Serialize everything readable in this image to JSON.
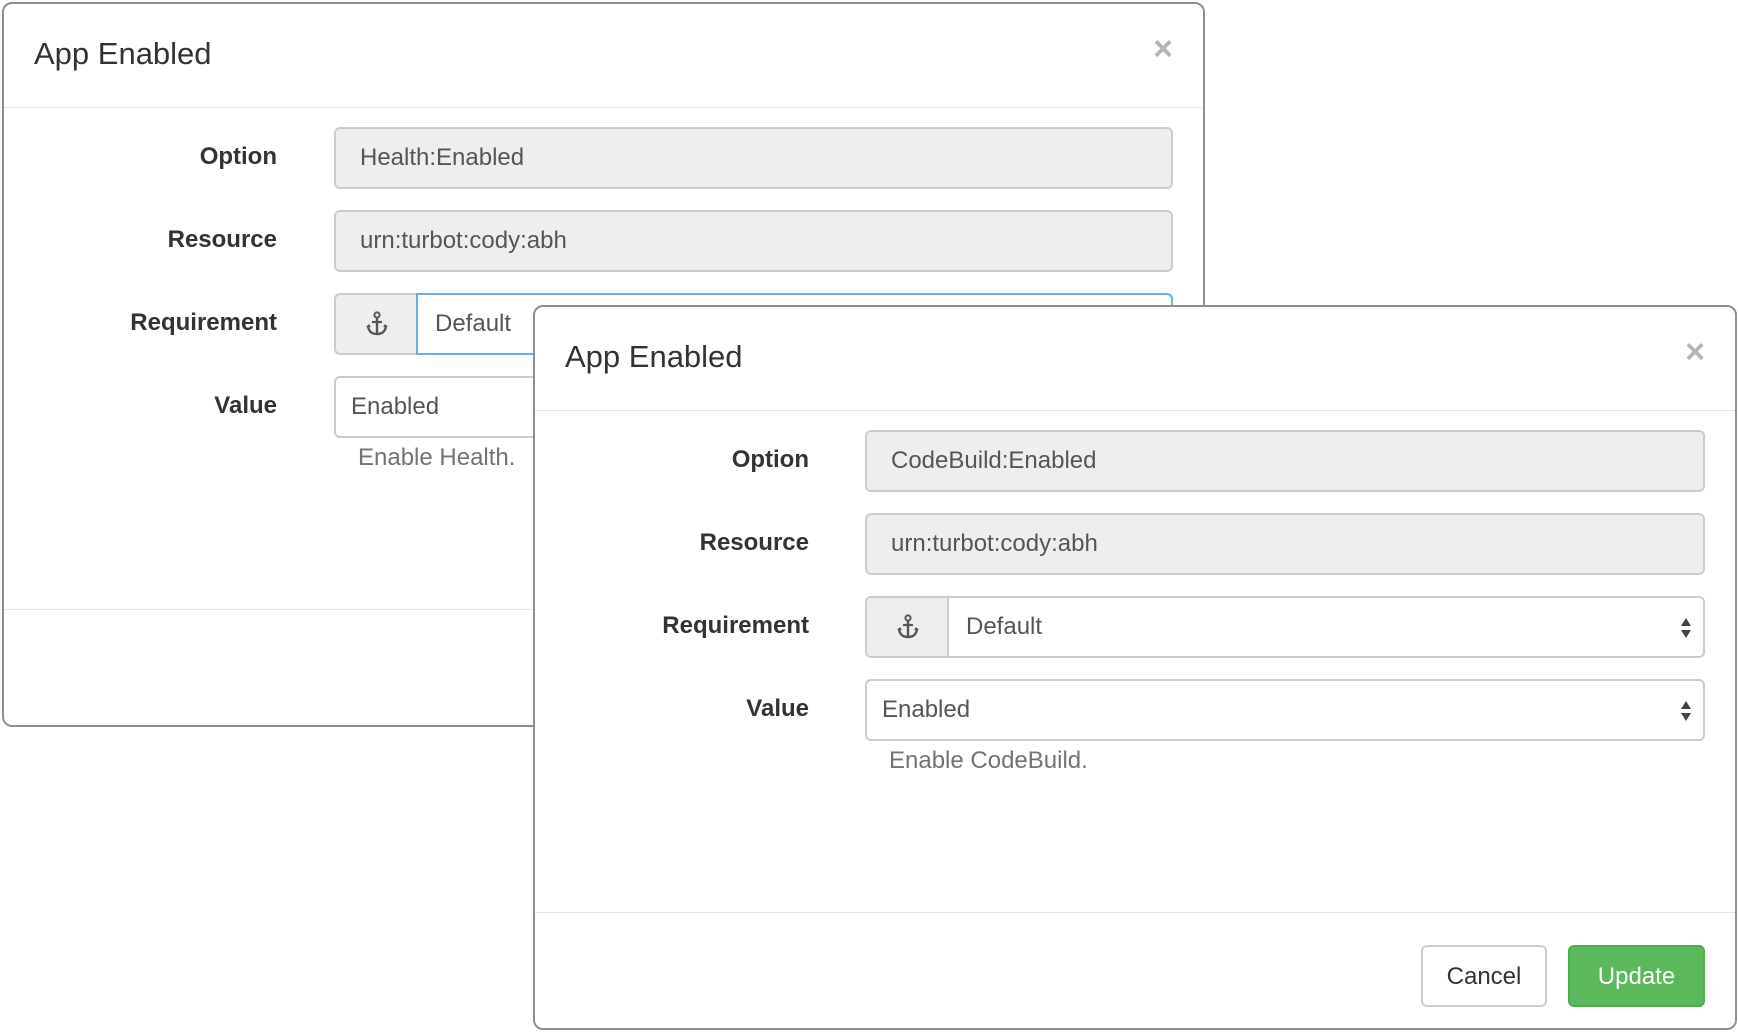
{
  "back_dialog": {
    "title": "App Enabled",
    "close_glyph": "×",
    "option": {
      "label": "Option",
      "value": "Health:Enabled"
    },
    "resource": {
      "label": "Resource",
      "value": "urn:turbot:cody:abh"
    },
    "requirement": {
      "label": "Requirement",
      "icon": "anchor-icon",
      "selected": "Default"
    },
    "value": {
      "label": "Value",
      "selected": "Enabled",
      "help": "Enable Health."
    }
  },
  "front_dialog": {
    "title": "App Enabled",
    "close_glyph": "×",
    "option": {
      "label": "Option",
      "value": "CodeBuild:Enabled"
    },
    "resource": {
      "label": "Resource",
      "value": "urn:turbot:cody:abh"
    },
    "requirement": {
      "label": "Requirement",
      "icon": "anchor-icon",
      "selected": "Default"
    },
    "value": {
      "label": "Value",
      "selected": "Enabled",
      "help": "Enable CodeBuild."
    },
    "footer": {
      "cancel_label": "Cancel",
      "update_label": "Update"
    }
  },
  "colors": {
    "update_button": "#5cb85c",
    "focus_border": "#66afe9",
    "readonly_bg": "#eeeeee"
  }
}
